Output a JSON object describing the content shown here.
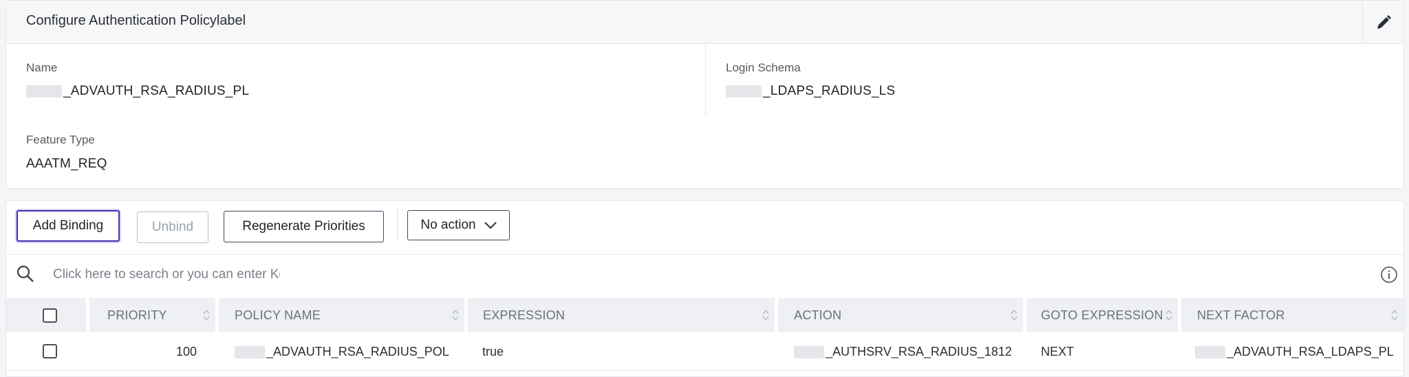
{
  "config": {
    "title": "Configure Authentication Policylabel",
    "name_label": "Name",
    "name_value": "_ADVAUTH_RSA_RADIUS_PL",
    "login_schema_label": "Login Schema",
    "login_schema_value": "_LDAPS_RADIUS_LS",
    "feature_type_label": "Feature Type",
    "feature_type_value": "AAATM_REQ"
  },
  "toolbar": {
    "add_binding": "Add Binding",
    "unbind": "Unbind",
    "regenerate_priorities": "Regenerate Priorities",
    "action_select": "No action"
  },
  "search": {
    "placeholder": "Click here to search or you can enter Key : Value format"
  },
  "table": {
    "headers": {
      "priority": "PRIORITY",
      "policy_name": "POLICY NAME",
      "expression": "EXPRESSION",
      "action": "ACTION",
      "goto_expression": "GOTO EXPRESSION",
      "next_factor": "NEXT FACTOR"
    },
    "rows": [
      {
        "priority": "100",
        "policy_name": "_ADVAUTH_RSA_RADIUS_POL",
        "expression": "true",
        "action": "_AUTHSRV_RSA_RADIUS_1812",
        "goto_expression": "NEXT",
        "next_factor": "_ADVAUTH_RSA_LDAPS_PL"
      }
    ]
  },
  "colors": {
    "focus_ring": "#4b2bb3",
    "header_bg": "#f6f7f9",
    "table_header_bg": "#eef0f3"
  }
}
